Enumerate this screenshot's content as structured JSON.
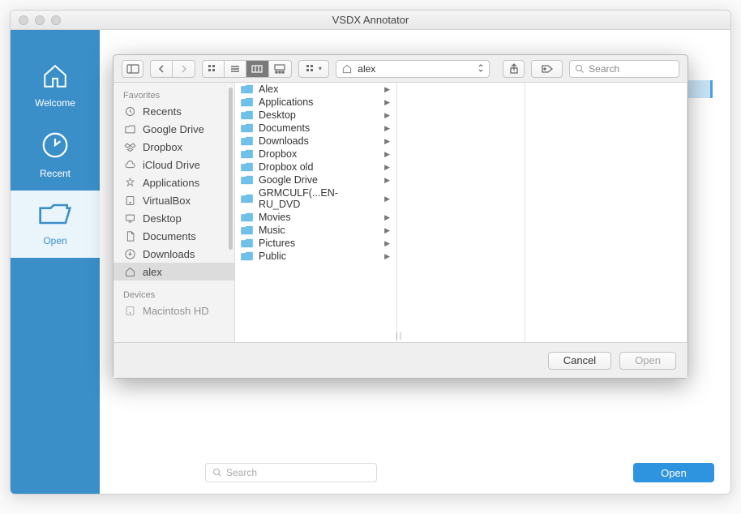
{
  "window": {
    "title": "VSDX Annotator"
  },
  "leftbar": {
    "items": [
      {
        "key": "welcome",
        "label": "Welcome",
        "icon": "home-icon"
      },
      {
        "key": "recent",
        "label": "Recent",
        "icon": "clock-icon"
      },
      {
        "key": "open",
        "label": "Open",
        "icon": "folder-open-icon"
      }
    ],
    "active": "open"
  },
  "bottom": {
    "search_placeholder": "Search",
    "open_label": "Open"
  },
  "dialog": {
    "toolbar": {
      "path_label": "alex",
      "search_placeholder": "Search"
    },
    "sidebar": {
      "favorites_label": "Favorites",
      "favorites": [
        {
          "label": "Recents",
          "icon": "recents-icon"
        },
        {
          "label": "Google Drive",
          "icon": "folder-icon"
        },
        {
          "label": "Dropbox",
          "icon": "dropbox-icon"
        },
        {
          "label": "iCloud Drive",
          "icon": "cloud-icon"
        },
        {
          "label": "Applications",
          "icon": "apps-icon"
        },
        {
          "label": "VirtualBox",
          "icon": "disk-icon"
        },
        {
          "label": "Desktop",
          "icon": "desktop-icon"
        },
        {
          "label": "Documents",
          "icon": "document-icon"
        },
        {
          "label": "Downloads",
          "icon": "downloads-icon"
        },
        {
          "label": "alex",
          "icon": "home-outline-icon"
        }
      ],
      "devices_label": "Devices",
      "devices": [
        {
          "label": "Macintosh HD",
          "icon": "disk-icon"
        }
      ]
    },
    "column": [
      {
        "label": "Alex"
      },
      {
        "label": "Applications"
      },
      {
        "label": "Desktop"
      },
      {
        "label": "Documents"
      },
      {
        "label": "Downloads"
      },
      {
        "label": "Dropbox"
      },
      {
        "label": "Dropbox old"
      },
      {
        "label": "Google Drive"
      },
      {
        "label": "GRMCULF(...EN-RU_DVD"
      },
      {
        "label": "Movies"
      },
      {
        "label": "Music"
      },
      {
        "label": "Pictures"
      },
      {
        "label": "Public"
      }
    ],
    "footer": {
      "cancel_label": "Cancel",
      "open_label": "Open"
    }
  },
  "colors": {
    "accent": "#3b8fc8",
    "btn": "#2f94e0"
  }
}
